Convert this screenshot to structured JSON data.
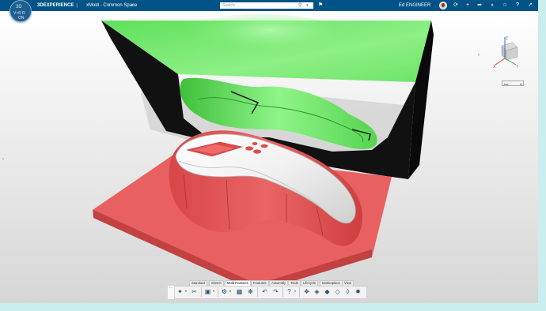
{
  "topbar": {
    "brand_main": "3DEXPERIENCE",
    "brand_sep": "|",
    "app": "xMold",
    "separator": "-",
    "space": "Common Space",
    "search_placeholder": "Search",
    "username": "Ed ENGINEER",
    "icons": [
      "search-icon",
      "tag-icon",
      "add-icon",
      "share-icon",
      "collaborate-icon",
      "help-icon",
      "fullscreen-icon"
    ],
    "colors": {
      "bar": "#005386"
    }
  },
  "compass": {
    "top": "3D",
    "left": "V+R",
    "right": "R",
    "bottom": "ON"
  },
  "viewport": {
    "view_mode": "Iso",
    "axis": {
      "x": "X",
      "y": "Y",
      "z": "Z"
    },
    "colors": {
      "core_green": "#76e86f",
      "cavity_red": "#e85a5a",
      "part_white": "#f4f4f4"
    }
  },
  "action_bar": {
    "tabs": [
      "Standard",
      "Sketch",
      "Mold Features",
      "Features",
      "Assembly",
      "Tools",
      "Lifecycle",
      "Marketplace",
      "View"
    ],
    "active_tab": "Mold Features"
  }
}
